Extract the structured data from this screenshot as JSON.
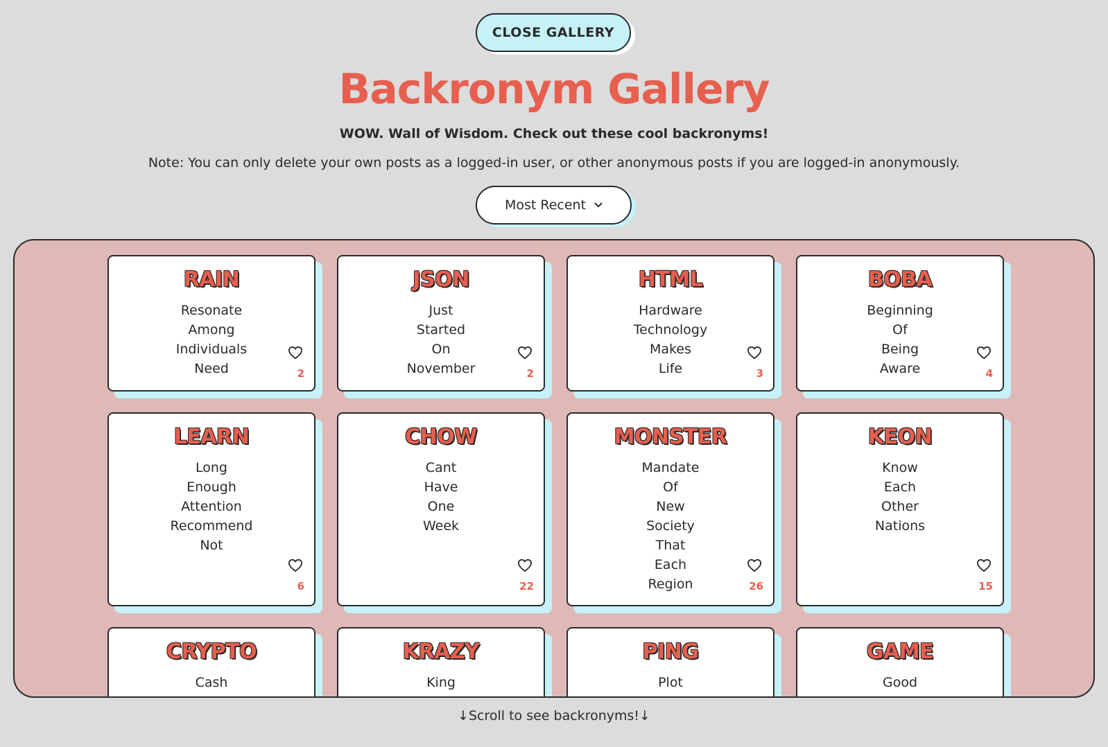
{
  "close_button": "CLOSE GALLERY",
  "title": "Backronym Gallery",
  "subtitle": "WOW. Wall of Wisdom. Check out these cool backronyms!",
  "note": "Note: You can only delete your own posts as a logged-in user, or other anonymous posts if you are logged-in anonymously.",
  "sort": {
    "selected": "Most Recent",
    "icon": "chevron-down-icon"
  },
  "scroll_hint": "↓Scroll to see backronyms!↓",
  "colors": {
    "accent": "#e65f4f",
    "card_shadow": "#c6f1f7",
    "gallery_bg": "#dfb9b8",
    "page_bg": "#dcdcdc"
  },
  "cards": [
    {
      "word": "RAIN",
      "words": [
        "Resonate",
        "Among",
        "Individuals",
        "Need"
      ],
      "likes": "2"
    },
    {
      "word": "JSON",
      "words": [
        "Just",
        "Started",
        "On",
        "November"
      ],
      "likes": "2"
    },
    {
      "word": "HTML",
      "words": [
        "Hardware",
        "Technology",
        "Makes",
        "Life"
      ],
      "likes": "3"
    },
    {
      "word": "BOBA",
      "words": [
        "Beginning",
        "Of",
        "Being",
        "Aware"
      ],
      "likes": "4"
    },
    {
      "word": "LEARN",
      "words": [
        "Long",
        "Enough",
        "Attention",
        "Recommend",
        "Not"
      ],
      "likes": "6"
    },
    {
      "word": "CHOW",
      "words": [
        "Cant",
        "Have",
        "One",
        "Week"
      ],
      "likes": "22"
    },
    {
      "word": "MONSTER",
      "words": [
        "Mandate",
        "Of",
        "New",
        "Society",
        "That",
        "Each",
        "Region"
      ],
      "likes": "26"
    },
    {
      "word": "KEON",
      "words": [
        "Know",
        "Each",
        "Other",
        "Nations"
      ],
      "likes": "15"
    },
    {
      "word": "CRYPTO",
      "words": [
        "Cash"
      ],
      "likes": ""
    },
    {
      "word": "KRAZY",
      "words": [
        "King"
      ],
      "likes": ""
    },
    {
      "word": "PING",
      "words": [
        "Plot"
      ],
      "likes": ""
    },
    {
      "word": "GAME",
      "words": [
        "Good"
      ],
      "likes": ""
    }
  ]
}
